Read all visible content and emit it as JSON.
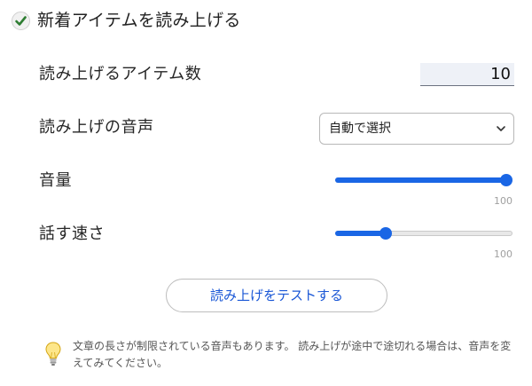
{
  "header": {
    "checkbox_checked": true,
    "label": "新着アイテムを読み上げる"
  },
  "settings": {
    "item_count": {
      "label": "読み上げるアイテム数",
      "value": "10"
    },
    "voice": {
      "label": "読み上げの音声",
      "selected": "自動で選択"
    },
    "volume": {
      "label": "音量",
      "value": 100,
      "max_label": "100"
    },
    "speed": {
      "label": "話す速さ",
      "value": 27,
      "max_label": "100"
    }
  },
  "test_button": {
    "label": "読み上げをテストする"
  },
  "note": {
    "icon": "lightbulb-icon",
    "text": "文章の長さが制限されている音声もあります。 読み上げが途中で途切れる場合は、音声を変えてみてください。"
  },
  "colors": {
    "accent": "#1a66e5",
    "check": "#2e7d32"
  }
}
